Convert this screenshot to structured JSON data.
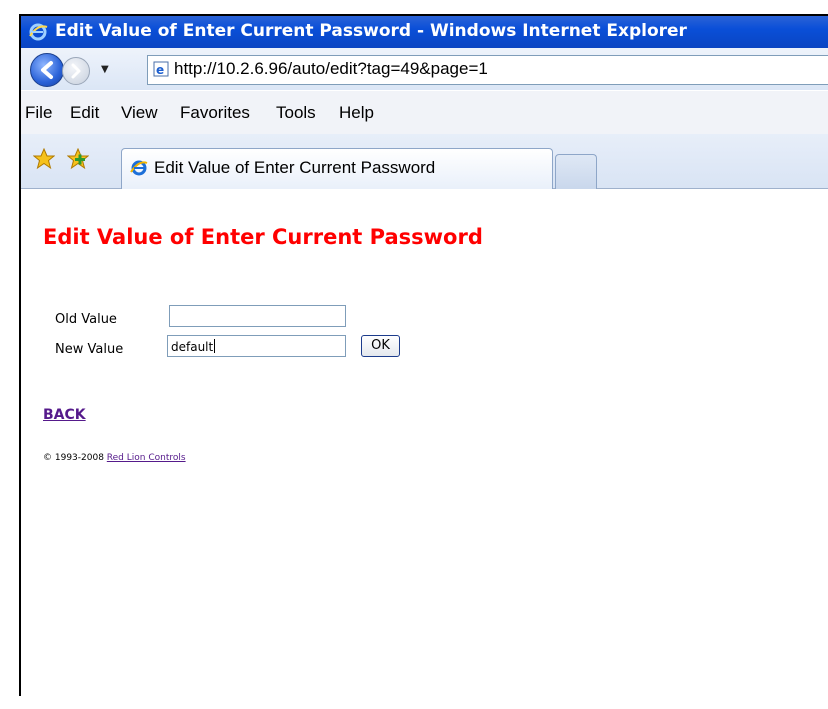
{
  "window": {
    "title": "Edit Value of Enter Current Password - Windows Internet Explorer"
  },
  "address_bar": {
    "url": "http://10.2.6.96/auto/edit?tag=49&page=1"
  },
  "menu": {
    "items": [
      "File",
      "Edit",
      "View",
      "Favorites",
      "Tools",
      "Help"
    ]
  },
  "tabs": {
    "active_title": "Edit Value of Enter Current Password"
  },
  "page": {
    "heading": "Edit Value of Enter Current Password",
    "old_value_label": "Old Value",
    "old_value": "",
    "new_value_label": "New Value",
    "new_value": "default",
    "ok_label": "OK",
    "back_link": "BACK",
    "copyright_prefix": "© 1993-2008",
    "company_link": "Red Lion Controls"
  },
  "colors": {
    "heading": "#ff0000",
    "titlebar": "#0a4fd8",
    "visited_link": "#551a8b"
  },
  "icons": {
    "titlebar": "ie-logo-icon",
    "back": "back-arrow-icon",
    "forward": "forward-arrow-icon",
    "page": "ie-page-icon",
    "favorites": "favorites-star-icon",
    "add_favorite": "add-favorite-icon"
  }
}
